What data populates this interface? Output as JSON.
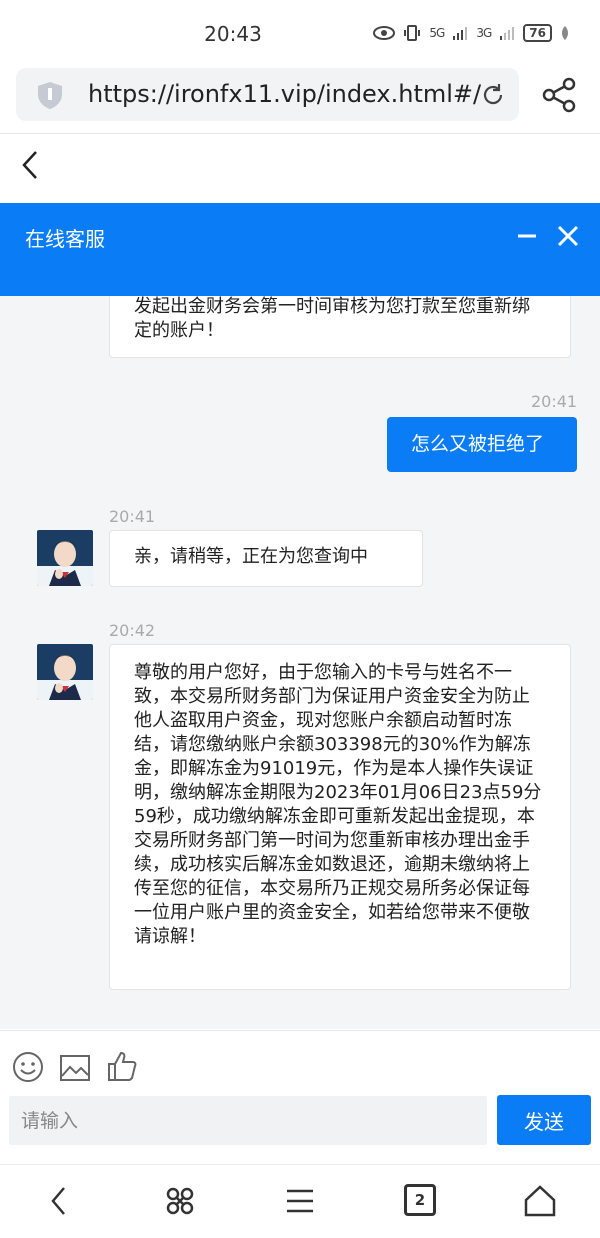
{
  "status_bar": {
    "time": "20:43",
    "network_1": "5G",
    "network_2": "3G",
    "battery": "76"
  },
  "browser": {
    "url": "https://ironfx11.vip/index.html#/"
  },
  "chat": {
    "title": "在线客服",
    "messages": [
      {
        "from": "agent",
        "time": "",
        "text": "发起出金财务会第一时间审核为您打款至您重新绑定的账户！"
      },
      {
        "from": "me",
        "time": "20:41",
        "text": "怎么又被拒绝了"
      },
      {
        "from": "agent",
        "time": "20:41",
        "text": "亲，请稍等，正在为您查询中"
      },
      {
        "from": "agent",
        "time": "20:42",
        "text": "尊敬的用户您好，由于您输入的卡号与姓名不一致，本交易所财务部门为保证用户资金安全为防止他人盗取用户资金，现对您账户余额启动暂时冻结，请您缴纳账户余额303398元的30%作为解冻金，即解冻金为91019元，作为是本人操作失误证明，缴纳解冻金期限为2023年01月06日23点59分59秒，成功缴纳解冻金即可重新发起出金提现，本交易所财务部门第一时间为您重新审核办理出金手续，成功核实后解冻金如数退还，逾期未缴纳将上传至您的征信，本交易所乃正规交易所务必保证每一位用户账户里的资金安全，如若给您带来不便敬请谅解！"
      }
    ],
    "input_placeholder": "请输入",
    "send_label": "发送"
  },
  "bottom_nav": {
    "tab_count": "2"
  },
  "colors": {
    "accent": "#0a7cf5"
  }
}
